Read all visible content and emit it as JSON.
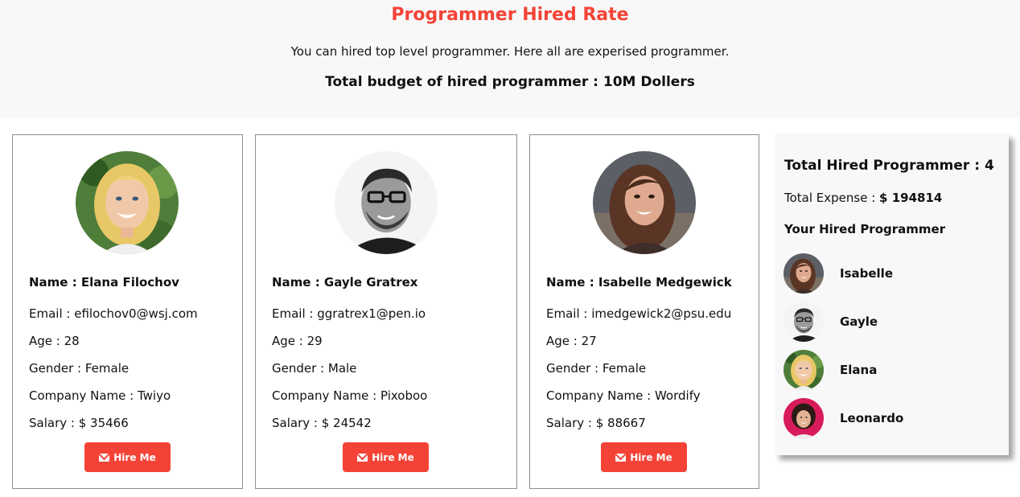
{
  "header": {
    "title": "Programmer Hired Rate",
    "subtitle": "You can hired top level programmer. Here all are experised programmer.",
    "budget": "Total budget of hired programmer : 10M Dollers"
  },
  "colors": {
    "accent": "#f44336",
    "header_bg": "#f8f8f8",
    "panel_bg": "#f8f8f8"
  },
  "labels": {
    "name": "Name : ",
    "email": "Email : ",
    "age": "Age : ",
    "gender": "Gender : ",
    "company": "Company Name : ",
    "salary": "Salary : $ ",
    "hire_button": "Hire Me",
    "hire_icon": "envelope-icon"
  },
  "programmers": [
    {
      "name": "Elana Filochov",
      "email": "efilochov0@wsj.com",
      "age": "28",
      "gender": "Female",
      "company": "Twiyo",
      "salary": "35466",
      "avatar": "blonde-woman-photo"
    },
    {
      "name": "Gayle Gratrex",
      "email": "ggratrex1@pen.io",
      "age": "29",
      "gender": "Male",
      "company": "Pixoboo",
      "salary": "24542",
      "avatar": "man-with-glasses-photo"
    },
    {
      "name": "Isabelle Medgewick",
      "email": "imedgewick2@psu.edu",
      "age": "27",
      "gender": "Female",
      "company": "Wordify",
      "salary": "88667",
      "avatar": "brunette-woman-photo"
    }
  ],
  "cart": {
    "total_label": "Total Hired Programmer : ",
    "total_count": "4",
    "expense_label": "Total Expense : ",
    "expense_value": "$ 194814",
    "list_title": "Your Hired Programmer",
    "hired": [
      {
        "name": "Isabelle",
        "avatar": "brunette-woman-photo"
      },
      {
        "name": "Gayle",
        "avatar": "man-with-glasses-photo"
      },
      {
        "name": "Elana",
        "avatar": "blonde-woman-photo"
      },
      {
        "name": "Leonardo",
        "avatar": "curly-hair-woman-photo"
      }
    ]
  }
}
